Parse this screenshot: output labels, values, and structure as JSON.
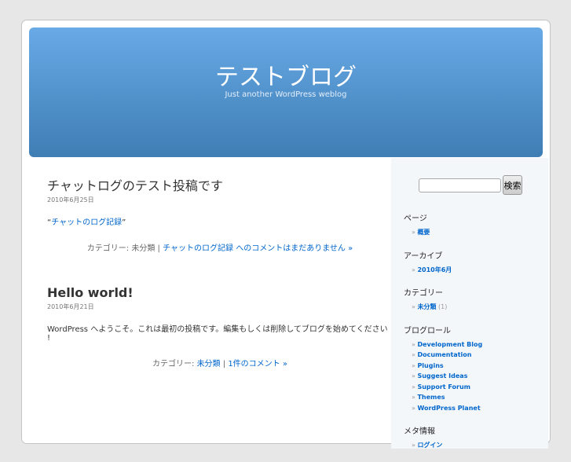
{
  "header": {
    "title": "テストブログ",
    "description": "Just another WordPress weblog"
  },
  "posts": [
    {
      "title": "チャットログのテスト投稿です",
      "date": "2010年6月25日",
      "entry_prefix": "“",
      "entry_link": "チャットのログ記録",
      "entry_suffix": "”",
      "meta_label": "カテゴリー:",
      "category": "未分類",
      "separator": "|",
      "comments": "チャットのログ記録 へのコメントはまだありません",
      "arrow": "»"
    },
    {
      "title": "Hello world!",
      "date": "2010年6月21日",
      "entry": "WordPress へようこそ。これは最初の投稿です。編集もしくは削除してブログを始めてください !",
      "meta_label": "カテゴリー:",
      "category": "未分類",
      "separator": "|",
      "comments": "1件のコメント",
      "arrow": "»"
    }
  ],
  "sidebar": {
    "search_button": "検索",
    "pages": {
      "title": "ページ",
      "items": [
        "概要"
      ]
    },
    "archives": {
      "title": "アーカイブ",
      "items": [
        "2010年6月"
      ]
    },
    "categories": {
      "title": "カテゴリー",
      "items": [
        {
          "label": "未分類",
          "count": "(1)"
        }
      ]
    },
    "blogroll": {
      "title": "ブログロール",
      "items": [
        "Development Blog",
        "Documentation",
        "Plugins",
        "Suggest Ideas",
        "Support Forum",
        "Themes",
        "WordPress Planet"
      ]
    },
    "meta": {
      "title": "メタ情報",
      "items": [
        "ログイン"
      ]
    }
  }
}
